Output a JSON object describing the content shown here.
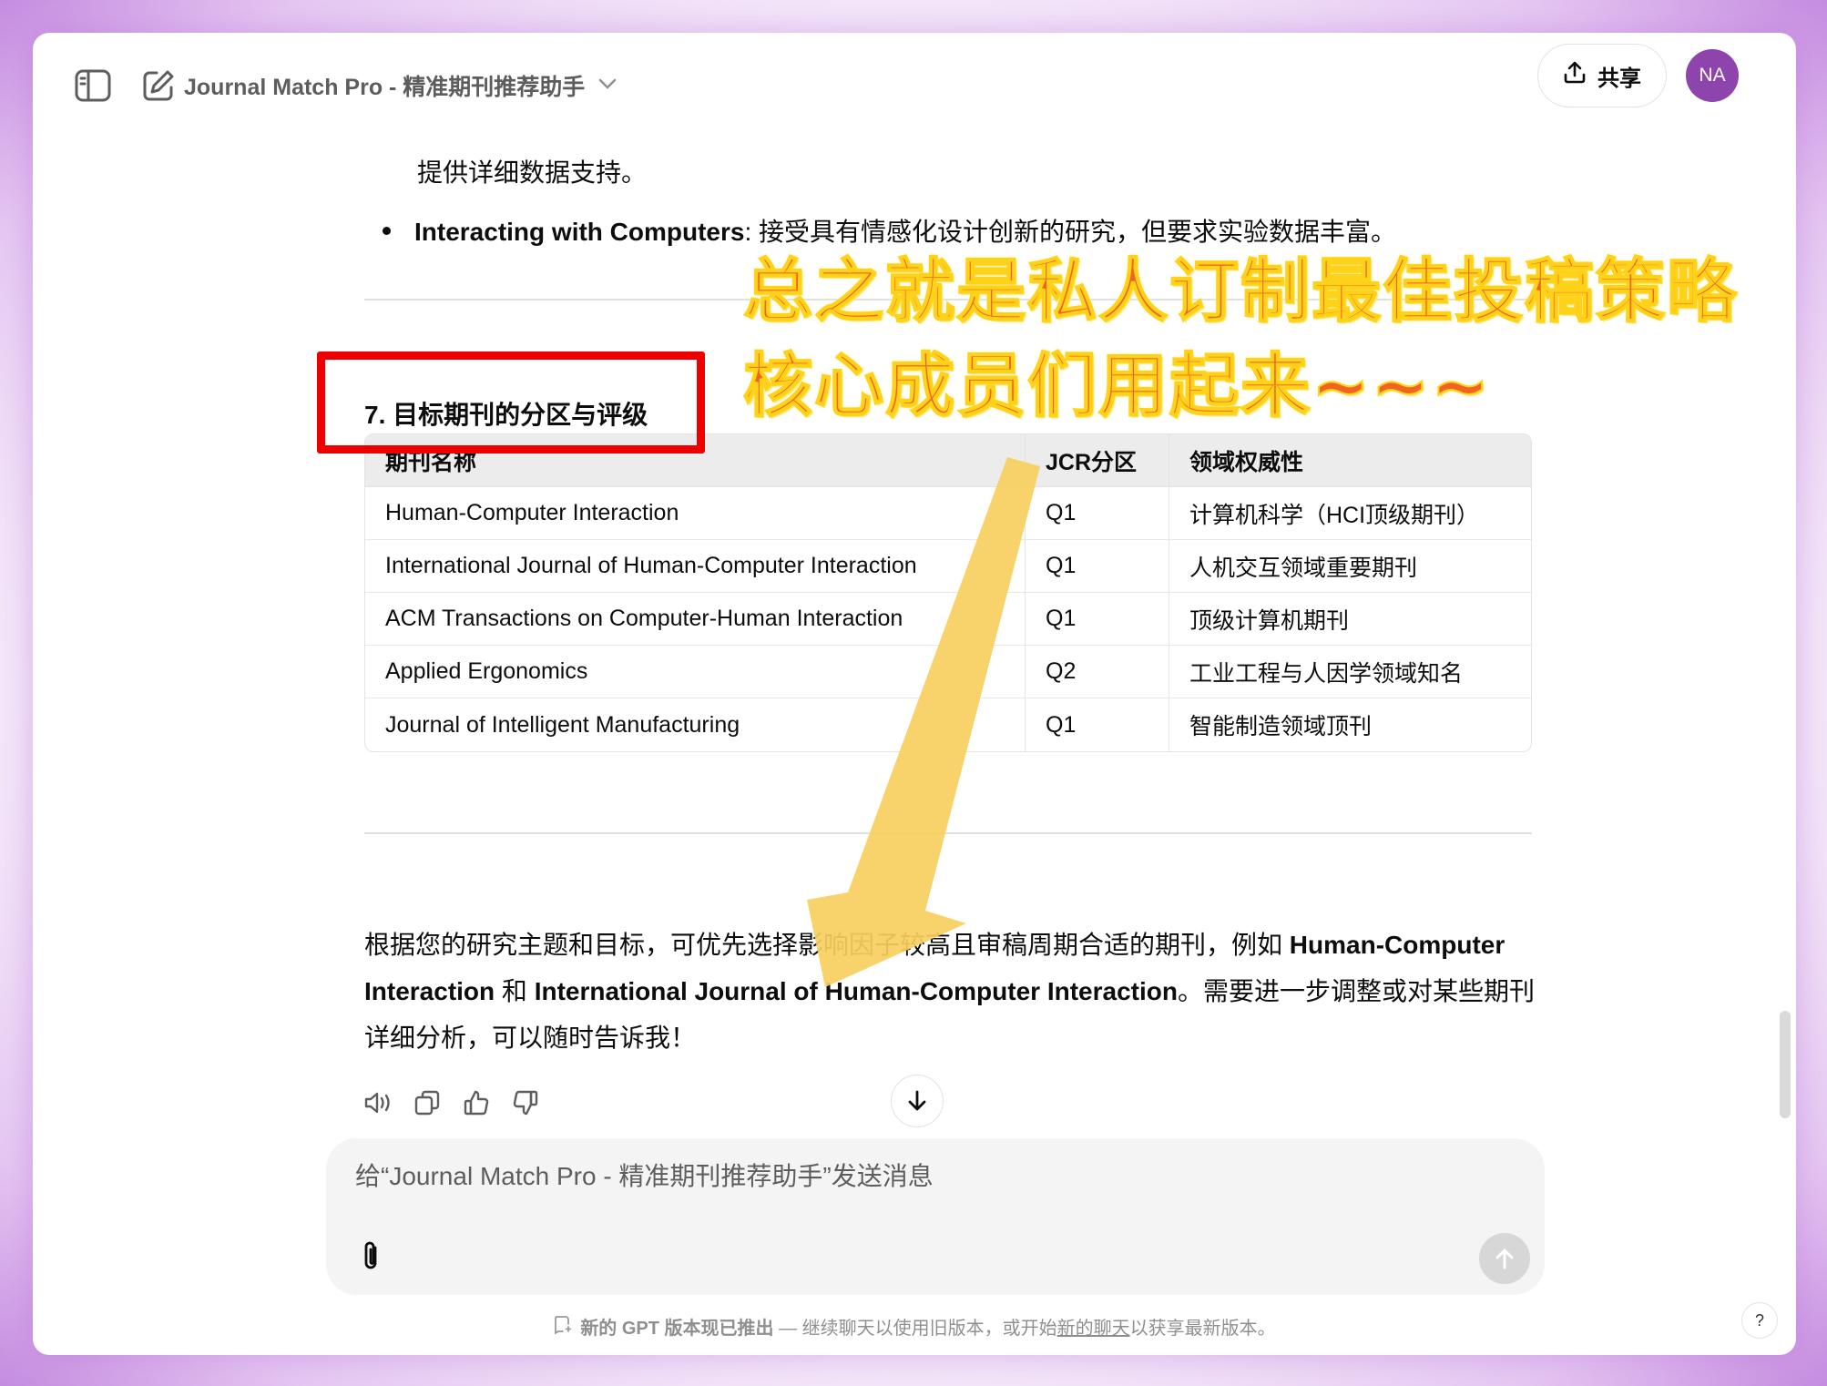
{
  "header": {
    "app_title": "Journal Match Pro - 精准期刊推荐助手",
    "share_label": "共享",
    "avatar_initials": "NA"
  },
  "content": {
    "line_top": "提供详细数据支持。",
    "bullet_bold": "Interacting with Computers",
    "bullet_rest": ": 接受具有情感化设计创新的研究，但要求实验数据丰富。",
    "section_title": "7. 目标期刊的分区与评级",
    "table": {
      "headers": [
        "期刊名称",
        "JCR分区",
        "领域权威性"
      ],
      "rows": [
        [
          "Human-Computer Interaction",
          "Q1",
          "计算机科学（HCI顶级期刊）"
        ],
        [
          "International Journal of Human-Computer Interaction",
          "Q1",
          "人机交互领域重要期刊"
        ],
        [
          "ACM Transactions on Computer-Human Interaction",
          "Q1",
          "顶级计算机期刊"
        ],
        [
          "Applied Ergonomics",
          "Q2",
          "工业工程与人因学领域知名"
        ],
        [
          "Journal of Intelligent Manufacturing",
          "Q1",
          "智能制造领域顶刊"
        ]
      ]
    },
    "para_1": "根据您的研究主题和目标，可优先选择影响因子较高且审稿周期合适的期刊，例如 ",
    "para_bold_1": "Human-Computer Interaction",
    "para_2": " 和 ",
    "para_bold_2": "International Journal of Human-Computer Interaction",
    "para_3": "。需要进一步调整或对某些期刊详细分析，可以随时告诉我！"
  },
  "overlay": {
    "line1": "总之就是私人订制最佳投稿策略",
    "line2": "核心成员们用起来~~~"
  },
  "composer": {
    "placeholder": "给“Journal Match Pro - 精准期刊推荐助手”发送消息"
  },
  "footer": {
    "notice_bold": "新的 GPT 版本现已推出",
    "notice_text": " — 继续聊天以使用旧版本，或开始",
    "notice_link": "新的聊天",
    "notice_tail": "以获享最新版本。",
    "help": "?"
  },
  "colors": {
    "overlay_text": "#f06422",
    "overlay_stroke": "#ffd21a",
    "highlight_box": "#ef0000",
    "arrow": "#f7cf5e",
    "avatar": "#8e44ad"
  }
}
